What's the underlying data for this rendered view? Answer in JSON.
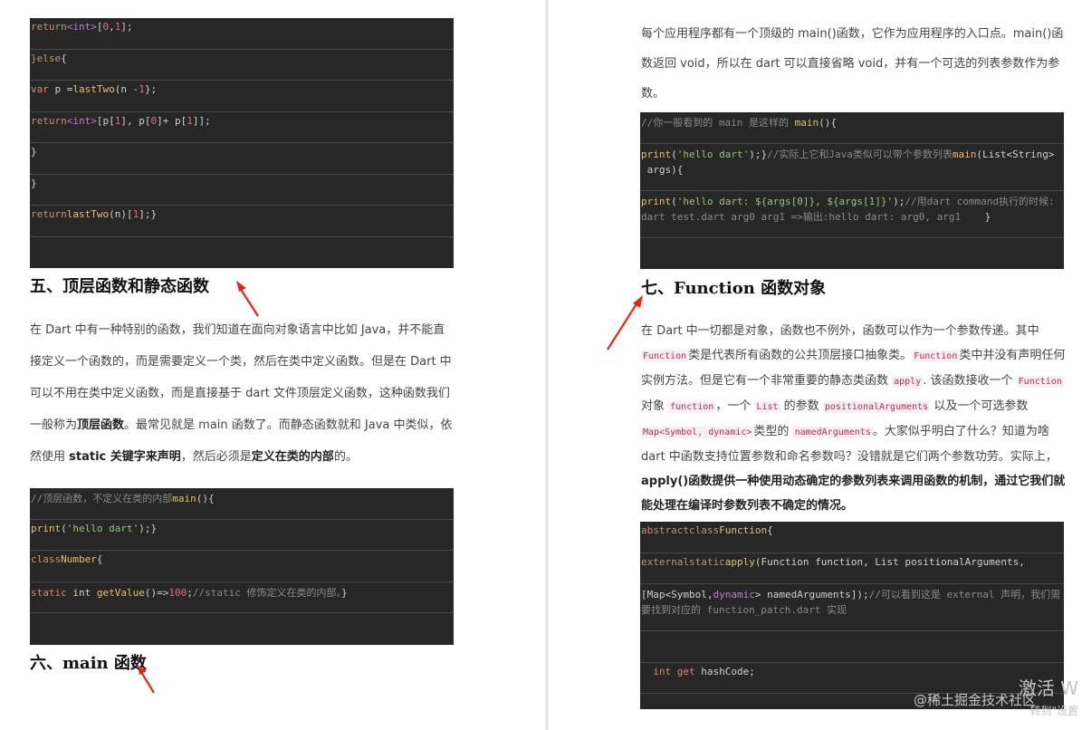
{
  "left": {
    "code_top": {
      "lines": [
        [
          [
            "kw",
            "return"
          ],
          [
            "ty",
            "<int>"
          ],
          [
            "",
            "["
          ],
          [
            "nm",
            "0"
          ],
          [
            "",
            ","
          ],
          [
            "nm",
            "1"
          ],
          [
            "",
            "];"
          ]
        ],
        [
          [
            "kw",
            "}else"
          ],
          [
            "",
            "{"
          ]
        ],
        [
          [
            "kw",
            "var"
          ],
          [
            "",
            " p ="
          ],
          [
            "fn",
            "lastTwo"
          ],
          [
            "",
            "(n -"
          ],
          [
            "nm",
            "1"
          ],
          [
            "",
            "};"
          ]
        ],
        [
          [
            "kw",
            "return"
          ],
          [
            "ty",
            "<int>"
          ],
          [
            "",
            "[p["
          ],
          [
            "nm",
            "1"
          ],
          [
            "",
            "], p["
          ],
          [
            "nm",
            "0"
          ],
          [
            "",
            "]+ p["
          ],
          [
            "nm",
            "1"
          ],
          [
            "",
            "]];"
          ]
        ],
        [
          [
            "",
            "}"
          ]
        ],
        [
          [
            "",
            "}"
          ]
        ],
        [
          [
            "kw",
            "return"
          ],
          [
            "fn",
            "lastTwo"
          ],
          [
            "",
            "(n)["
          ],
          [
            "nm",
            "1"
          ],
          [
            "",
            "];}"
          ]
        ],
        []
      ]
    },
    "section5": {
      "title": "五、顶层函数和静态函数",
      "para": [
        [
          "",
          "在 Dart 中有一种特别的函数，我们知道在面向对象语言中比如 Java，并不能直接定义一个函数的，而是需要定义一个类，然后在类中定义函数。但是在 Dart 中可以不用在类中定义函数，而是直接基于 dart 文件顶层定义函数，这种函数我们一般称为"
        ],
        [
          "b",
          "顶层函数"
        ],
        [
          "",
          "。最常见就是 main 函数了。而静态函数就和 Java 中类似，依然使用 "
        ],
        [
          "b",
          "static 关键字来声明"
        ],
        [
          "",
          "，然后必须是"
        ],
        [
          "b",
          "定义在类的内部"
        ],
        [
          "",
          "的。"
        ]
      ]
    },
    "code_mid": {
      "lines": [
        [
          [
            "cm",
            "//顶层函数，不定义在类的内部"
          ],
          [
            "fn",
            "main"
          ],
          [
            "",
            "(){"
          ]
        ],
        [
          [
            "fn",
            "print"
          ],
          [
            "",
            "("
          ],
          [
            "st",
            "'hello dart'"
          ],
          [
            "",
            ");}"
          ]
        ],
        [
          [
            "kw",
            "class"
          ],
          [
            "fn",
            "Number"
          ],
          [
            "",
            "{"
          ]
        ],
        [
          [
            "kw",
            "static"
          ],
          [
            "",
            " int "
          ],
          [
            "fn",
            "getValue"
          ],
          [
            "",
            "()=>"
          ],
          [
            "nm",
            "100"
          ],
          [
            "",
            ";"
          ],
          [
            "cm",
            "//static 修饰定义在类的内部。"
          ],
          [
            "",
            "}"
          ]
        ],
        []
      ]
    },
    "section6": {
      "title": "六、main 函数"
    }
  },
  "right": {
    "intro": "每个应用程序都有一个顶级的 main()函数，它作为应用程序的入口点。main()函数返回 void，所以在 dart 可以直接省略 void，并有一个可选的列表参数作为参数。",
    "code_top": {
      "lines": [
        {
          "segs": [
            [
              "cm",
              "//你一般看到的 main 是这样的 "
            ],
            [
              "fn",
              "main"
            ],
            [
              "",
              "(){"
            ]
          ]
        },
        {
          "tall": true,
          "segs": [
            [
              "fn",
              "print"
            ],
            [
              "",
              "("
            ],
            [
              "st",
              "'hello dart'"
            ],
            [
              "",
              ");}"
            ],
            [
              "cm",
              "//实际上它和Java类似可以带个参数列表"
            ],
            [
              "fn",
              "main"
            ],
            [
              "",
              "(List<String>"
            ],
            [
              "",
              ""
            ],
            [
              "",
              "\n args){"
            ]
          ]
        },
        {
          "tall": true,
          "segs": [
            [
              "fn",
              "print"
            ],
            [
              "",
              "("
            ],
            [
              "st",
              "'hello dart: ${args[0]}, ${args[1]}'"
            ],
            [
              "",
              ");"
            ],
            [
              "cm",
              "//用dart command执行的时候: dart test.dart arg0 arg1 =>输出:hello dart: arg0, arg1"
            ],
            [
              "",
              "    }"
            ]
          ]
        },
        {
          "segs": []
        }
      ]
    },
    "section7": {
      "title": "七、Function 函数对象",
      "para": [
        [
          "",
          "在 Dart 中一切都是对象，函数也不例外，函数可以作为一个参数传递。其中 "
        ],
        [
          "c",
          "Function"
        ],
        [
          "",
          "类是代表所有函数的公共顶层接口抽象类。"
        ],
        [
          "c",
          "Function"
        ],
        [
          "",
          "类中并没有声明任何实例方法。但是它有一个非常重要的静态类函数 "
        ],
        [
          "c",
          "apply"
        ],
        [
          "",
          ". 该函数接收一个 "
        ],
        [
          "c",
          "Function"
        ],
        [
          "",
          " 对象 "
        ],
        [
          "c",
          "function"
        ],
        [
          "",
          "，一个 "
        ],
        [
          "c",
          "List"
        ],
        [
          "",
          " 的参数 "
        ],
        [
          "c",
          "positionalArguments"
        ],
        [
          "",
          " 以及一个可选参数 "
        ],
        [
          "c",
          "Map<Symbol, dynamic>"
        ],
        [
          "",
          "类型的 "
        ],
        [
          "c",
          "namedArguments"
        ],
        [
          "",
          "。大家似乎明白了什么？知道为啥 dart 中函数支持位置参数和命名参数吗？没错就是它们两个参数功劳。实际上，"
        ],
        [
          "b",
          "apply()函数提供一种使用动态确定的参数列表来调用函数的机制，通过它我们就能处理在编译时参数列表不确定的情况。"
        ]
      ]
    },
    "code_bottom": {
      "lines": [
        {
          "segs": [
            [
              "kw",
              "abstract"
            ],
            [
              "kw",
              "class"
            ],
            [
              "fn",
              "Function"
            ],
            [
              "",
              "{"
            ]
          ]
        },
        {
          "segs": [
            [
              "kw",
              "external"
            ],
            [
              "kw",
              "static"
            ],
            [
              "fn",
              "apply"
            ],
            [
              "",
              "(Function function, List positionalArguments,"
            ]
          ]
        },
        {
          "tall": true,
          "segs": [
            [
              "",
              "[Map<Symbol,"
            ],
            [
              "ty",
              "dynamic"
            ],
            [
              "",
              "> namedArguments]);"
            ],
            [
              "cm",
              "//可以看到这是 external 声明，我们需要找到对应的 function_patch.dart 实现"
            ]
          ]
        },
        {
          "segs": []
        },
        {
          "segs": [
            [
              "",
              "  "
            ],
            [
              "kw",
              "int"
            ],
            [
              "",
              " "
            ],
            [
              "kw",
              "get"
            ],
            [
              "",
              " hashCode;"
            ]
          ]
        },
        {
          "segs": []
        }
      ]
    },
    "watermark": "@稀土掘金技术社区",
    "activate_line1": "激活 W",
    "activate_line2": "转到\"设置"
  }
}
